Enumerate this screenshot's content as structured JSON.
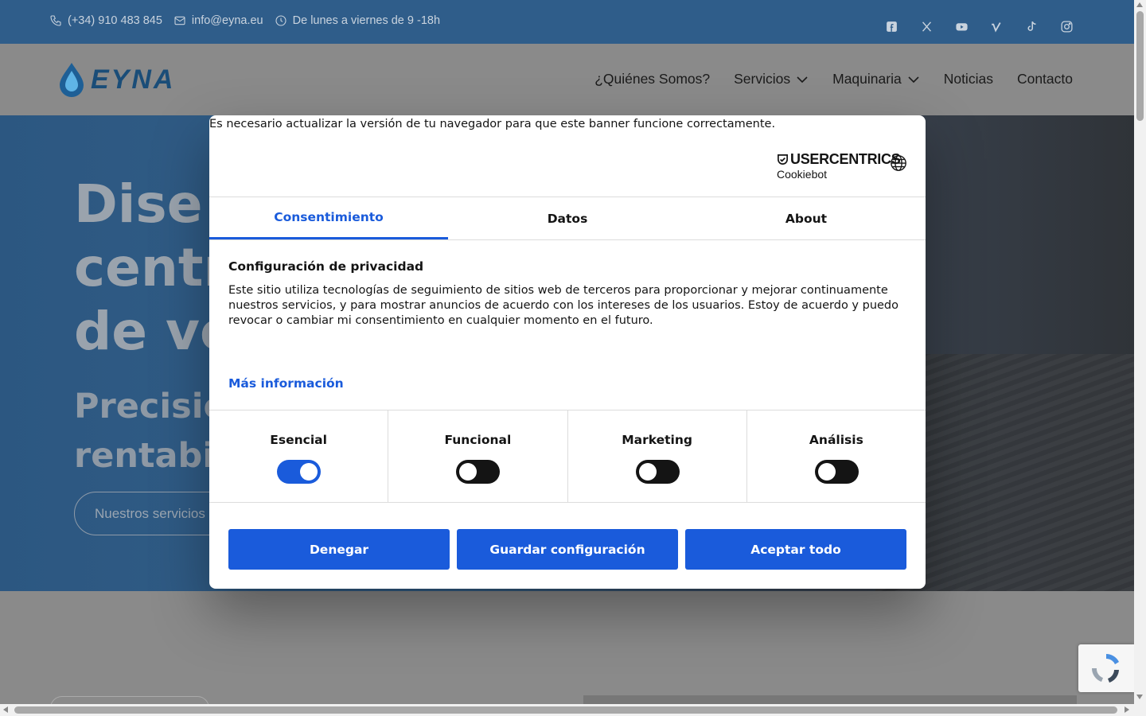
{
  "topbar": {
    "phone": "(+34) 910 483 845",
    "email": "info@eyna.eu",
    "hours": "De lunes a viernes de 9 -18h",
    "social": [
      "facebook-icon",
      "x-icon",
      "youtube-icon",
      "vimeo-icon",
      "tiktok-icon",
      "instagram-icon"
    ]
  },
  "header": {
    "logo_text": "EYNA",
    "nav": [
      {
        "label": "¿Quiénes Somos?",
        "dropdown": false
      },
      {
        "label": "Servicios",
        "dropdown": true
      },
      {
        "label": "Maquinaria",
        "dropdown": true
      },
      {
        "label": "Noticias",
        "dropdown": false
      },
      {
        "label": "Contacto",
        "dropdown": false
      }
    ]
  },
  "hero": {
    "title_lines": [
      "Dise",
      "centr",
      "de ve"
    ],
    "subtitle_lines": [
      "Precisió",
      "rentabil"
    ],
    "cta": "Nuestros servicios"
  },
  "cookie": {
    "warning": "Es necesario actualizar la versión de tu navegador para que este banner funcione correctamente.",
    "brand_main": "USERCENTRICS",
    "brand_sub": "Cookiebot",
    "tabs": [
      {
        "label": "Consentimiento",
        "active": true
      },
      {
        "label": "Datos",
        "active": false
      },
      {
        "label": "About",
        "active": false
      }
    ],
    "privacy_title": "Configuración de privacidad",
    "privacy_text": "Este sitio utiliza tecnologías de seguimiento de sitios web de terceros para proporcionar y mejorar continuamente nuestros servicios, y para mostrar anuncios de acuerdo con los intereses de los usuarios. Estoy de acuerdo y puedo revocar o cambiar mi consentimiento en cualquier momento en el futuro.",
    "more_info": "Más información",
    "categories": [
      {
        "label": "Esencial",
        "enabled": true
      },
      {
        "label": "Funcional",
        "enabled": false
      },
      {
        "label": "Marketing",
        "enabled": false
      },
      {
        "label": "Análisis",
        "enabled": false
      }
    ],
    "buttons": {
      "deny": "Denegar",
      "save": "Guardar configuración",
      "accept": "Aceptar todo"
    }
  },
  "colors": {
    "accent": "#1a5bdb",
    "topbar": "#2f5d8a"
  }
}
